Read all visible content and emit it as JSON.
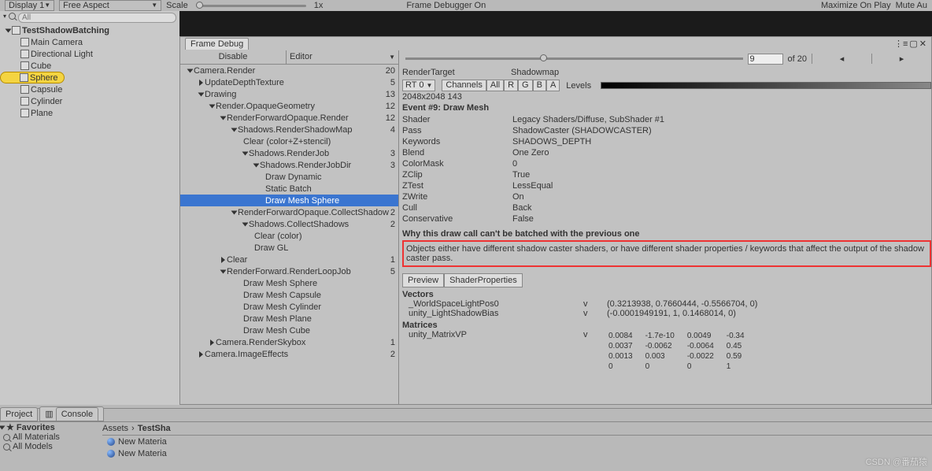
{
  "toolbar": {
    "display": "Display 1",
    "aspect": "Free Aspect",
    "scale": "Scale",
    "scale_val": "1x",
    "fd": "Frame Debugger On",
    "max": "Maximize On Play",
    "mute": "Mute Au"
  },
  "search_placeholder": "All",
  "hierarchy": {
    "root": "TestShadowBatching",
    "items": [
      "Main Camera",
      "Directional Light",
      "Cube",
      "Sphere",
      "Capsule",
      "Cylinder",
      "Plane"
    ],
    "selected": "Sphere"
  },
  "fd": {
    "title": "Frame Debug",
    "disable": "Disable",
    "editor": "Editor",
    "cur": "9",
    "total": "of 20",
    "tree": [
      {
        "l": "Camera.Render",
        "n": "20",
        "d": 0,
        "tri": 1
      },
      {
        "l": "UpdateDepthTexture",
        "n": "5",
        "d": 1,
        "tri": 0
      },
      {
        "l": "Drawing",
        "n": "13",
        "d": 1,
        "tri": 1
      },
      {
        "l": "Render.OpaqueGeometry",
        "n": "12",
        "d": 2,
        "tri": 1
      },
      {
        "l": "RenderForwardOpaque.Render",
        "n": "12",
        "d": 3,
        "tri": 1
      },
      {
        "l": "Shadows.RenderShadowMap",
        "n": "4",
        "d": 4,
        "tri": 1
      },
      {
        "l": "Clear (color+Z+stencil)",
        "n": "",
        "d": 5
      },
      {
        "l": "Shadows.RenderJob",
        "n": "3",
        "d": 5,
        "tri": 1
      },
      {
        "l": "Shadows.RenderJobDir",
        "n": "3",
        "d": 6,
        "tri": 1
      },
      {
        "l": "Draw Dynamic",
        "n": "",
        "d": 7
      },
      {
        "l": "Static Batch",
        "n": "",
        "d": 7
      },
      {
        "l": "Draw Mesh Sphere",
        "n": "",
        "d": 7,
        "sel": 1
      },
      {
        "l": "RenderForwardOpaque.CollectShadow",
        "n": "2",
        "d": 4,
        "tri": 1
      },
      {
        "l": "Shadows.CollectShadows",
        "n": "2",
        "d": 5,
        "tri": 1
      },
      {
        "l": "Clear (color)",
        "n": "",
        "d": 6
      },
      {
        "l": "Draw GL",
        "n": "",
        "d": 6
      },
      {
        "l": "Clear",
        "n": "1",
        "d": 3,
        "tri": 0
      },
      {
        "l": "RenderForward.RenderLoopJob",
        "n": "5",
        "d": 3,
        "tri": 1
      },
      {
        "l": "Draw Mesh Sphere",
        "n": "",
        "d": 5
      },
      {
        "l": "Draw Mesh Capsule",
        "n": "",
        "d": 5
      },
      {
        "l": "Draw Mesh Cylinder",
        "n": "",
        "d": 5
      },
      {
        "l": "Draw Mesh Plane",
        "n": "",
        "d": 5
      },
      {
        "l": "Draw Mesh Cube",
        "n": "",
        "d": 5
      },
      {
        "l": "Camera.RenderSkybox",
        "n": "1",
        "d": 2,
        "tri": 0
      },
      {
        "l": "Camera.ImageEffects",
        "n": "2",
        "d": 1,
        "tri": 0
      }
    ],
    "rt": {
      "label": "RenderTarget",
      "val": "Shadowmap",
      "sel": "RT 0",
      "channels": "Channels",
      "all": "All",
      "R": "R",
      "G": "G",
      "B": "B",
      "A": "A",
      "levels": "Levels"
    },
    "dim": "2048x2048 143",
    "event": "Event #9: Draw Mesh",
    "props": [
      [
        "Shader",
        "Legacy Shaders/Diffuse, SubShader #1"
      ],
      [
        "Pass",
        "ShadowCaster (SHADOWCASTER)"
      ],
      [
        "Keywords",
        "SHADOWS_DEPTH"
      ],
      [
        "Blend",
        "One Zero"
      ],
      [
        "ColorMask",
        "0"
      ],
      [
        "ZClip",
        "True"
      ],
      [
        "ZTest",
        "LessEqual"
      ],
      [
        "ZWrite",
        "On"
      ],
      [
        "Cull",
        "Back"
      ],
      [
        "Conservative",
        "False"
      ]
    ],
    "why": "Why this draw call can't be batched with the previous one",
    "why_text": "Objects either have different shadow caster shaders, or have different shader properties / keywords that affect the output of the shadow caster pass.",
    "preview": "Preview",
    "sp": "ShaderProperties",
    "vectors": "Vectors",
    "vec": [
      [
        "_WorldSpaceLightPos0",
        "v",
        "(0.3213938, 0.7660444, -0.5566704, 0)"
      ],
      [
        "unity_LightShadowBias",
        "v",
        "(-0.0001949191, 1, 0.1468014, 0)"
      ]
    ],
    "matrices": "Matrices",
    "matname": "unity_MatrixVP",
    "matt": "v",
    "matrix": [
      [
        "0.0084",
        "-1.7e-10",
        "0.0049",
        "-0.34"
      ],
      [
        "0.0037",
        "-0.0062",
        "-0.0064",
        "0.45"
      ],
      [
        "0.0013",
        "0.003",
        "-0.0022",
        "0.59"
      ],
      [
        "0",
        "0",
        "0",
        "1"
      ]
    ]
  },
  "project": {
    "tab1": "Project",
    "tab2": "Console",
    "fav": "Favorites",
    "allm": "All Materials",
    "allmod": "All Models",
    "assets": "Assets",
    "testsha": "TestSha",
    "nm": "New Materia"
  },
  "watermark": "CSDN @番茄猿"
}
